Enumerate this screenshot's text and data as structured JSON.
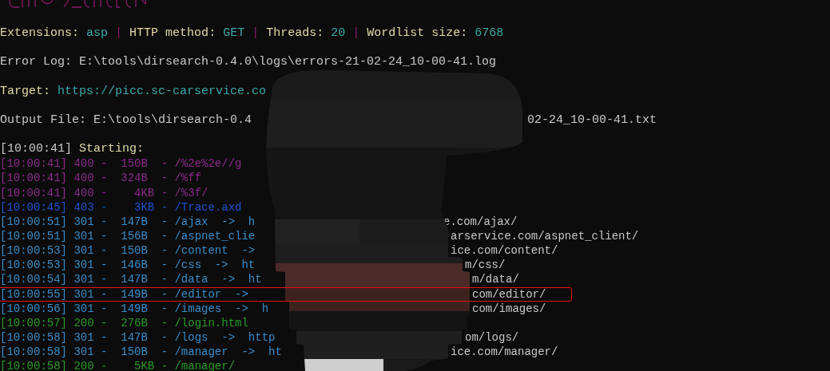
{
  "separator": "|",
  "config": [
    {
      "label": "Extensions:",
      "value": "asp"
    },
    {
      "label": "HTTP method:",
      "value": "GET"
    },
    {
      "label": "Threads:",
      "value": "20"
    },
    {
      "label": "Wordlist size:",
      "value": "6768"
    }
  ],
  "error_log": {
    "label": "Error Log:",
    "value": "E:\\tools\\dirsearch-0.4.0\\logs\\errors-21-02-24_10-00-41.log"
  },
  "target": {
    "label": "Target:",
    "value": "https://picc.sc-carservice.co"
  },
  "output_file": {
    "label": "Output File:",
    "value": "E:\\tools\\dirsearch-0.4",
    "value_end": "02-24_10-00-41.txt"
  },
  "starting": {
    "time": "[10:00:41]",
    "text": "Starting:"
  },
  "log": [
    {
      "text": "[10:00:41] 400 -  150B  - /%2e%2e//g",
      "color": "#8a2a8a",
      "highlighted": false
    },
    {
      "text": "[10:00:41] 400 -  324B  - /%ff",
      "color": "#8a2a8a",
      "highlighted": false
    },
    {
      "text": "[10:00:41] 400 -    4KB - /%3f/",
      "color": "#8a2a8a",
      "highlighted": false
    },
    {
      "text": "[10:00:45] 403 -    3KB - /Trace.axd",
      "color": "#2050c8",
      "highlighted": false
    },
    {
      "text": "[10:00:51] 301 -  147B  - /ajax  ->  h",
      "url_end": "e.com/ajax/",
      "color": "#3a8cc8",
      "highlighted": false
    },
    {
      "text": "[10:00:51] 301 -  156B  - /aspnet_clie",
      "url_end": "arservice.com/aspnet_client/",
      "color": "#3a8cc8",
      "highlighted": false
    },
    {
      "text": "[10:00:53] 301 -  150B  - /content  ->",
      "url_end": "ice.com/content/",
      "color": "#3a8cc8",
      "highlighted": false
    },
    {
      "text": "[10:00:53] 301 -  146B  - /css  ->  ht",
      "url_end": "m/css/",
      "color": "#3a8cc8",
      "highlighted": false
    },
    {
      "text": "[10:00:54] 301 -  147B  - /data  ->  ht",
      "url_end": "m/data/",
      "color": "#3a8cc8",
      "highlighted": false
    },
    {
      "text": "[10:00:55] 301 -  149B  - /editor  ->",
      "url_end": "com/editor/",
      "color": "#3a8cc8",
      "highlighted": true
    },
    {
      "text": "[10:00:56] 301 -  149B  - /images  ->  h",
      "url_end": "com/images/",
      "color": "#3a8cc8",
      "highlighted": false
    },
    {
      "text": "[10:00:57] 200 -  276B  - /login.html",
      "color": "#2a9a2a",
      "highlighted": false
    },
    {
      "text": "[10:00:58] 301 -  147B  - /logs  ->  http",
      "url_end": "om/logs/",
      "color": "#3a8cc8",
      "highlighted": false
    },
    {
      "text": "[10:00:58] 301 -  150B  - /manager  ->  ht",
      "url_end": "ice.com/manager/",
      "color": "#3a8cc8",
      "highlighted": false
    },
    {
      "text": "[10:00:58] 200 -    5KB - /manager/",
      "color": "#2a9a2a",
      "highlighted": false
    }
  ]
}
